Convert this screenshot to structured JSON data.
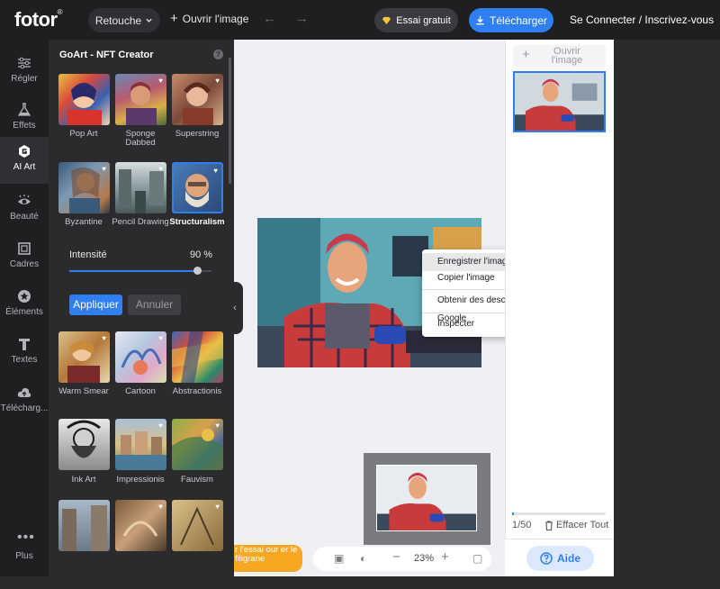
{
  "topbar": {
    "logo": "fotor",
    "logo_mark": "®",
    "retouche": "Retouche",
    "open_image": "Ouvrir l'image",
    "trial": "Essai gratuit",
    "download": "Télécharger",
    "login": "Se Connecter / Inscrivez-vous"
  },
  "leftnav": {
    "items": [
      {
        "label": "Régler",
        "icon": "sliders-icon"
      },
      {
        "label": "Effets",
        "icon": "flask-icon"
      },
      {
        "label": "AI Art",
        "icon": "ai-icon"
      },
      {
        "label": "Beauté",
        "icon": "eye-icon"
      },
      {
        "label": "Cadres",
        "icon": "frame-icon"
      },
      {
        "label": "Éléments",
        "icon": "star-icon"
      },
      {
        "label": "Textes",
        "icon": "text-icon"
      },
      {
        "label": "Télécharg...",
        "icon": "cloud-upload-icon"
      },
      {
        "label": "Plus",
        "icon": "more-icon"
      }
    ],
    "active": "AI Art"
  },
  "panel": {
    "title": "GoArt - NFT Creator",
    "help": "?",
    "styles": [
      {
        "label": "Pop Art"
      },
      {
        "label": "Sponge Dabbed"
      },
      {
        "label": "Superstring"
      },
      {
        "label": "Byzantine"
      },
      {
        "label": "Pencil Drawing"
      },
      {
        "label": "Structuralism"
      },
      {
        "label": "Warm Smear"
      },
      {
        "label": "Cartoon"
      },
      {
        "label": "Abstractionis"
      },
      {
        "label": "Ink Art"
      },
      {
        "label": "Impressionis"
      },
      {
        "label": "Fauvism"
      }
    ],
    "intensity_label": "Intensité",
    "intensity_value": "90 %",
    "intensity_fraction": 0.9,
    "apply": "Appliquer",
    "cancel": "Annuler"
  },
  "canvas": {
    "promo": "r l'essai our er le filigrane",
    "zoom": "23%"
  },
  "context_menu": {
    "items": [
      "Enregistrer l'image sous...",
      "Copier l'image",
      "Obtenir des descriptions d'images de Google",
      "Inspecter"
    ],
    "submenu_arrow": "▸"
  },
  "rightpanel": {
    "open_image": "Ouvrir l'image",
    "count": "1/50",
    "clear_all": "Effacer Tout",
    "help": "Aide",
    "progress_fraction": 0.02
  },
  "colors": {
    "accent": "#2f7ff3",
    "dark_bg": "#1f1f22",
    "panel_bg": "#2b2b2e",
    "promo": "#f7a823"
  }
}
